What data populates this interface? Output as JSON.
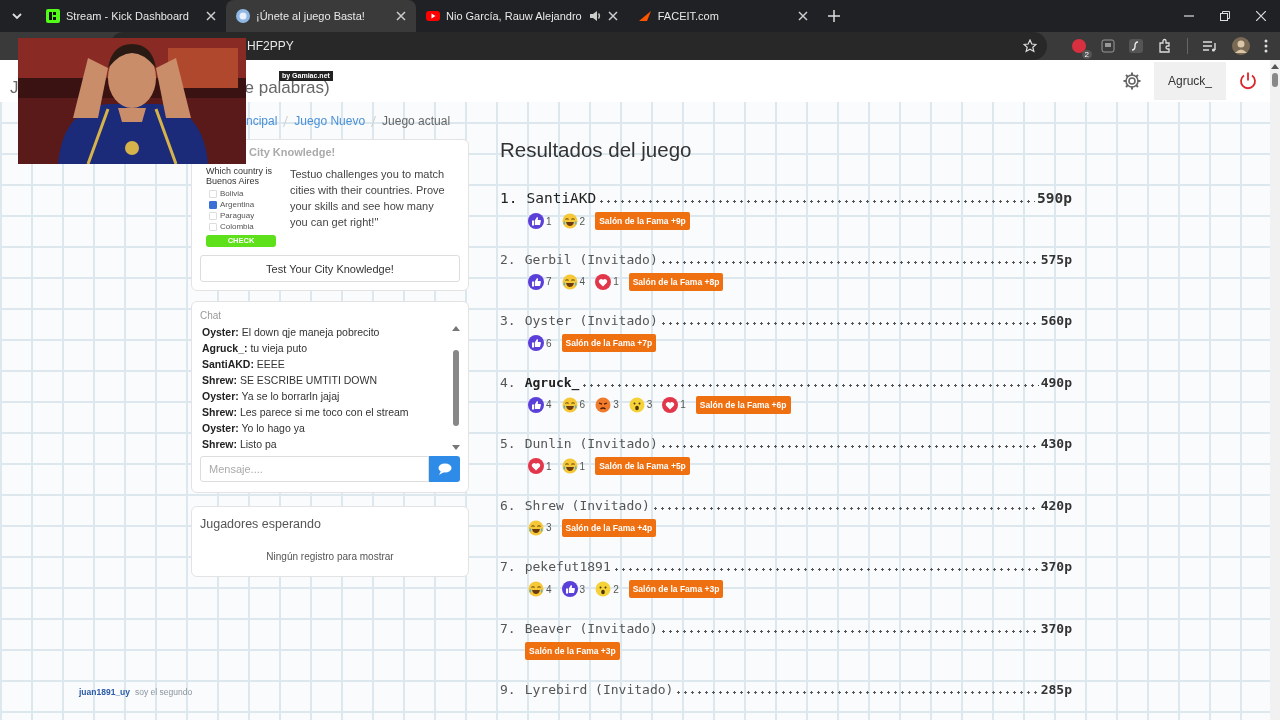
{
  "browser": {
    "tabs": [
      {
        "title": "Stream - Kick Dashboard",
        "selected": false,
        "audio": false
      },
      {
        "title": "¡Únete al juego Basta!",
        "selected": true,
        "audio": false
      },
      {
        "title": "Nio García, Rauw Alejandro",
        "selected": false,
        "audio": true
      },
      {
        "title": "FACEIT.com",
        "selected": false,
        "audio": false
      }
    ],
    "address": "HF2PPY",
    "extension_badge": "2"
  },
  "webcam": {
    "kind": "picture",
    "credit": "by Gamiac.net"
  },
  "header": {
    "title_start": "J",
    "title_end": "e palabras)",
    "user": "Agruck_"
  },
  "breadcrumbs": [
    {
      "label": "ncipal",
      "link": true
    },
    {
      "label": "Juego Nuevo",
      "link": true
    },
    {
      "label": "Juego actual",
      "link": false
    }
  ],
  "ad": {
    "title": "City Knowledge!",
    "quiz": {
      "question": "Which country is Buenos Aires",
      "options": [
        {
          "label": "Bolivia",
          "checked": false
        },
        {
          "label": "Argentina",
          "checked": true
        },
        {
          "label": "Paraguay",
          "checked": false
        },
        {
          "label": "Colombia",
          "checked": false
        }
      ],
      "button": "CHECK"
    },
    "text": "Testuo challenges you to match cities with their countries. Prove your skills and see how many you can get right!\"",
    "button": "Test Your City Knowledge!"
  },
  "chat": {
    "title": "Chat",
    "messages": [
      {
        "user": "Oyster:",
        "text": "El down qje maneja pobrecito"
      },
      {
        "user": "Agruck_:",
        "text": "tu vieja puto"
      },
      {
        "user": "SantiAKD:",
        "text": "EEEE"
      },
      {
        "user": "Shrew:",
        "text": "SE ESCRIBE UMTITI DOWN"
      },
      {
        "user": "Oyster:",
        "text": "Ya se lo borrarln jajaj"
      },
      {
        "user": "Shrew:",
        "text": "Les parece si me toco con el stream"
      },
      {
        "user": "Oyster:",
        "text": "Yo lo hago ya"
      },
      {
        "user": "Shrew:",
        "text": "Listo pa"
      }
    ],
    "placeholder": "Mensaje...."
  },
  "waiting": {
    "title": "Jugadores esperando",
    "empty": "Ningún registro para mostrar"
  },
  "results": {
    "title": "Resultados del juego",
    "rows": [
      {
        "rank": "1.",
        "name": "SantiAKD",
        "points": "590p",
        "current_user": false,
        "reactions": [
          {
            "kind": "like",
            "count": "1"
          },
          {
            "kind": "laugh",
            "count": "2"
          }
        ],
        "badge": "Salón de la Fama +9p"
      },
      {
        "rank": "2.",
        "name": "Gerbil (Invitado)",
        "points": "575p",
        "current_user": false,
        "reactions": [
          {
            "kind": "like",
            "count": "7"
          },
          {
            "kind": "laugh",
            "count": "4"
          },
          {
            "kind": "love",
            "count": "1"
          }
        ],
        "badge": "Salón de la Fama +8p"
      },
      {
        "rank": "3.",
        "name": "Oyster (Invitado)",
        "points": "560p",
        "current_user": false,
        "reactions": [
          {
            "kind": "like",
            "count": "6"
          }
        ],
        "badge": "Salón de la Fama +7p"
      },
      {
        "rank": "4.",
        "name": "Agruck_",
        "points": "490p",
        "current_user": true,
        "reactions": [
          {
            "kind": "like",
            "count": "4"
          },
          {
            "kind": "laugh",
            "count": "6"
          },
          {
            "kind": "angry",
            "count": "3"
          },
          {
            "kind": "wow",
            "count": "3"
          },
          {
            "kind": "love",
            "count": "1"
          }
        ],
        "badge": "Salón de la Fama +6p"
      },
      {
        "rank": "5.",
        "name": "Dunlin (Invitado)",
        "points": "430p",
        "current_user": false,
        "reactions": [
          {
            "kind": "love",
            "count": "1"
          },
          {
            "kind": "laugh",
            "count": "1"
          }
        ],
        "badge": "Salón de la Fama +5p"
      },
      {
        "rank": "6.",
        "name": "Shrew (Invitado)",
        "points": "420p",
        "current_user": false,
        "reactions": [
          {
            "kind": "laugh",
            "count": "3"
          }
        ],
        "badge": "Salón de la Fama +4p"
      },
      {
        "rank": "7.",
        "name": "pekefut1891",
        "points": "370p",
        "current_user": false,
        "reactions": [
          {
            "kind": "laugh",
            "count": "4"
          },
          {
            "kind": "like",
            "count": "3"
          },
          {
            "kind": "wow",
            "count": "2"
          }
        ],
        "badge": "Salón de la Fama +3p"
      },
      {
        "rank": "7.",
        "name": "Beaver (Invitado)",
        "points": "370p",
        "current_user": false,
        "reactions": [],
        "badge": "Salón de la Fama +3p"
      },
      {
        "rank": "9.",
        "name": "Lyrebird (Invitado)",
        "points": "285p",
        "current_user": false,
        "reactions": []
      }
    ]
  },
  "stream_chat": {
    "user": "juan1891_uy",
    "text": "soy el segundo"
  }
}
